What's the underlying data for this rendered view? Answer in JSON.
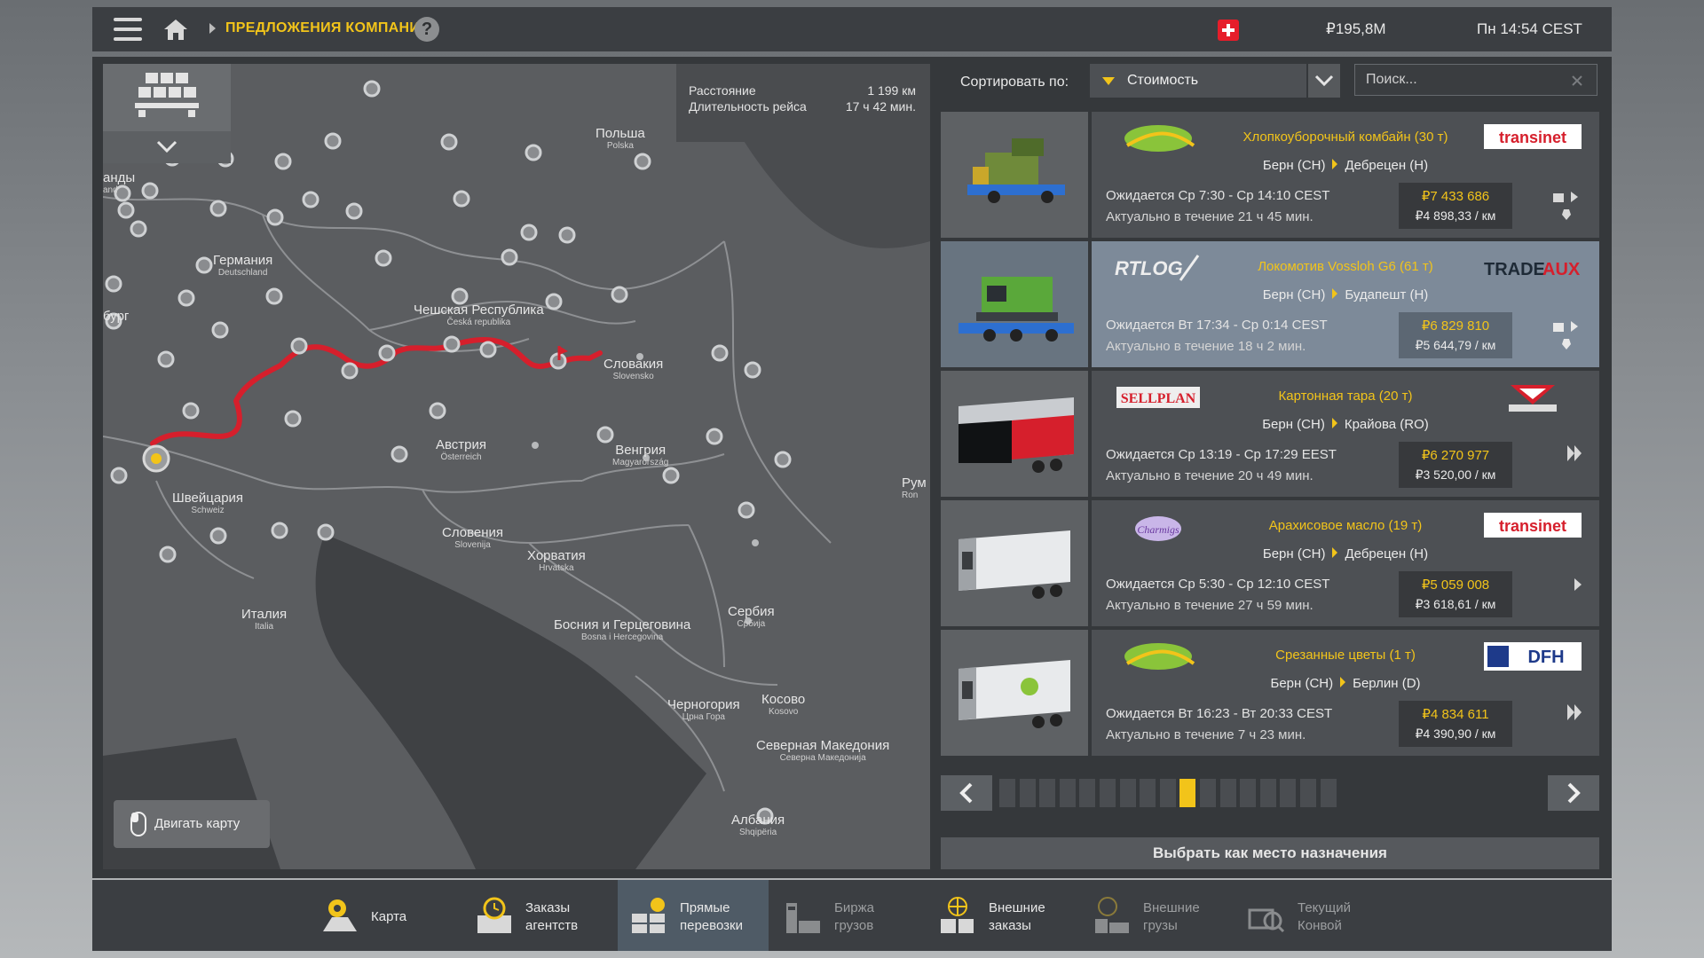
{
  "topbar": {
    "breadcrumb": "ПРЕДЛОЖЕНИЯ КОМПАНИЙ",
    "help": "?",
    "money": "₽195,8M",
    "clock": "Пн 14:54 CEST"
  },
  "map": {
    "distance_label": "Расстояние",
    "distance_value": "1 199 км",
    "duration_label": "Длительность рейса",
    "duration_value": "17 ч 42 мин.",
    "move_label": "Двигать карту",
    "countries": [
      {
        "name": "Польша",
        "local": "Polska"
      },
      {
        "name": "Германия",
        "local": "Deutschland"
      },
      {
        "name": "Чешская Республика",
        "local": "Česká republika"
      },
      {
        "name": "Словакия",
        "local": "Slovensko"
      },
      {
        "name": "Австрия",
        "local": "Österreich"
      },
      {
        "name": "Венгрия",
        "local": "Magyarország"
      },
      {
        "name": "Швейцария",
        "local": "Schweiz"
      },
      {
        "name": "Словения",
        "local": "Slovenija"
      },
      {
        "name": "Хорватия",
        "local": "Hrvatska"
      },
      {
        "name": "Италия",
        "local": "Italia"
      },
      {
        "name": "Сербия",
        "local": "Србија"
      },
      {
        "name": "Босния и Герцеговина",
        "local": "Bosna i Hercegovina"
      },
      {
        "name": "Черногория",
        "local": "Црна Гора"
      },
      {
        "name": "Косово",
        "local": "Kosovo"
      },
      {
        "name": "Северная Македония",
        "local": "Северна Македонија"
      },
      {
        "name": "Албания",
        "local": "Shqipëria"
      },
      {
        "name": "Рум",
        "local": "Ron"
      },
      {
        "name": "анды",
        "local": "and"
      },
      {
        "name": "бург",
        "local": ""
      }
    ]
  },
  "sort": {
    "label": "Сортировать по:",
    "value": "Стоимость",
    "search_placeholder": "Поиск..."
  },
  "offers": [
    {
      "cargo": "Хлопкоуборочный комбайн (30 т)",
      "from": "Берн (CH)",
      "to": "Дебрецен (H)",
      "expected": "Ожидается Ср 7:30 - Ср 14:10 CEST",
      "valid": "Актуально в течение 21 ч 45 мин.",
      "price": "₽7 433 686",
      "per_km": "₽4 898,33 / км",
      "company_left": "agrofoods",
      "company_right": "transinet"
    },
    {
      "cargo": "Локомотив Vossloh G6 (61 т)",
      "from": "Берн (CH)",
      "to": "Будапешт (H)",
      "expected": "Ожидается Вт 17:34 - Ср 0:14 CEST",
      "valid": "Актуально в течение 18 ч 2 мин.",
      "price": "₽6 829 810",
      "per_km": "₽5 644,79 / км",
      "company_left": "RTLOG",
      "company_right": "TRADEAUX"
    },
    {
      "cargo": "Картонная тара (20 т)",
      "from": "Берн (CH)",
      "to": "Крайова (RO)",
      "expected": "Ожидается Ср 13:19 - Ср 17:29 EEST",
      "valid": "Актуально в течение 20 ч 49 мин.",
      "price": "₽6 270 977",
      "per_km": "₽3 520,00 / км",
      "company_left": "SELLPLAN",
      "company_right": "Balkan Loco"
    },
    {
      "cargo": "Арахисовое масло (19 т)",
      "from": "Берн (CH)",
      "to": "Дебрецен (H)",
      "expected": "Ожидается Ср 5:30 - Ср 12:10 CEST",
      "valid": "Актуально в течение 27 ч 59 мин.",
      "price": "₽5 059 008",
      "per_km": "₽3 618,61 / км",
      "company_left": "Charmigs",
      "company_right": "transinet"
    },
    {
      "cargo": "Срезанные цветы (1 т)",
      "from": "Берн (CH)",
      "to": "Берлин (D)",
      "expected": "Ожидается Вт 16:23 - Вт 20:33 CEST",
      "valid": "Актуально в течение 7 ч 23 мин.",
      "price": "₽4 834 611",
      "per_km": "₽4 390,90 / км",
      "company_left": "agrofoods",
      "company_right": "DFH"
    }
  ],
  "pager": {
    "total_pages": 17,
    "current_page": 10
  },
  "destination_button": "Выбрать как место назначения",
  "tabs": [
    {
      "label1": "Карта",
      "label2": "",
      "icon": "map-icon",
      "state": "normal"
    },
    {
      "label1": "Заказы",
      "label2": "агентств",
      "icon": "agency-icon",
      "state": "normal"
    },
    {
      "label1": "Прямые",
      "label2": "перевозки",
      "icon": "direct-icon",
      "state": "active"
    },
    {
      "label1": "Биржа",
      "label2": "грузов",
      "icon": "freight-market-icon",
      "state": "dim"
    },
    {
      "label1": "Внешние",
      "label2": "заказы",
      "icon": "external-contracts-icon",
      "state": "normal"
    },
    {
      "label1": "Внешние",
      "label2": "грузы",
      "icon": "external-cargo-icon",
      "state": "dim"
    },
    {
      "label1": "Текущий",
      "label2": "Конвой",
      "icon": "convoy-icon",
      "state": "dim"
    }
  ]
}
